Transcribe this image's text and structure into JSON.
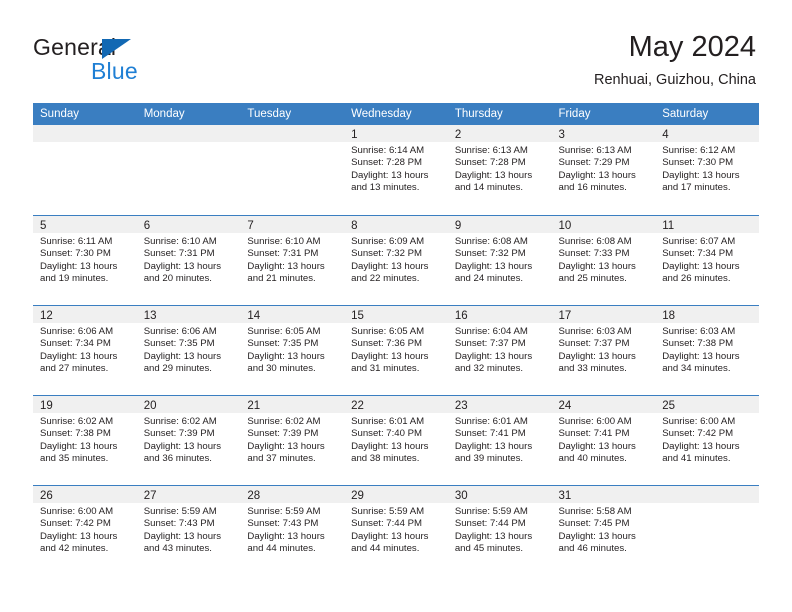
{
  "brand": {
    "name_part1": "General",
    "name_part2": "Blue",
    "triangle_color": "#1268b3",
    "blue_text_color": "#1f7fd4"
  },
  "header": {
    "title": "May 2024",
    "subtitle": "Renhuai, Guizhou, China"
  },
  "theme": {
    "header_blue": "#3a7ec1",
    "daynum_band": "#f0f0f0",
    "text": "#231f20"
  },
  "weekdays": [
    "Sunday",
    "Monday",
    "Tuesday",
    "Wednesday",
    "Thursday",
    "Friday",
    "Saturday"
  ],
  "weeks": [
    [
      {
        "day": "",
        "sunrise": "",
        "sunset": "",
        "daylight1": "",
        "daylight2": ""
      },
      {
        "day": "",
        "sunrise": "",
        "sunset": "",
        "daylight1": "",
        "daylight2": ""
      },
      {
        "day": "",
        "sunrise": "",
        "sunset": "",
        "daylight1": "",
        "daylight2": ""
      },
      {
        "day": "1",
        "sunrise": "Sunrise: 6:14 AM",
        "sunset": "Sunset: 7:28 PM",
        "daylight1": "Daylight: 13 hours",
        "daylight2": "and 13 minutes."
      },
      {
        "day": "2",
        "sunrise": "Sunrise: 6:13 AM",
        "sunset": "Sunset: 7:28 PM",
        "daylight1": "Daylight: 13 hours",
        "daylight2": "and 14 minutes."
      },
      {
        "day": "3",
        "sunrise": "Sunrise: 6:13 AM",
        "sunset": "Sunset: 7:29 PM",
        "daylight1": "Daylight: 13 hours",
        "daylight2": "and 16 minutes."
      },
      {
        "day": "4",
        "sunrise": "Sunrise: 6:12 AM",
        "sunset": "Sunset: 7:30 PM",
        "daylight1": "Daylight: 13 hours",
        "daylight2": "and 17 minutes."
      }
    ],
    [
      {
        "day": "5",
        "sunrise": "Sunrise: 6:11 AM",
        "sunset": "Sunset: 7:30 PM",
        "daylight1": "Daylight: 13 hours",
        "daylight2": "and 19 minutes."
      },
      {
        "day": "6",
        "sunrise": "Sunrise: 6:10 AM",
        "sunset": "Sunset: 7:31 PM",
        "daylight1": "Daylight: 13 hours",
        "daylight2": "and 20 minutes."
      },
      {
        "day": "7",
        "sunrise": "Sunrise: 6:10 AM",
        "sunset": "Sunset: 7:31 PM",
        "daylight1": "Daylight: 13 hours",
        "daylight2": "and 21 minutes."
      },
      {
        "day": "8",
        "sunrise": "Sunrise: 6:09 AM",
        "sunset": "Sunset: 7:32 PM",
        "daylight1": "Daylight: 13 hours",
        "daylight2": "and 22 minutes."
      },
      {
        "day": "9",
        "sunrise": "Sunrise: 6:08 AM",
        "sunset": "Sunset: 7:32 PM",
        "daylight1": "Daylight: 13 hours",
        "daylight2": "and 24 minutes."
      },
      {
        "day": "10",
        "sunrise": "Sunrise: 6:08 AM",
        "sunset": "Sunset: 7:33 PM",
        "daylight1": "Daylight: 13 hours",
        "daylight2": "and 25 minutes."
      },
      {
        "day": "11",
        "sunrise": "Sunrise: 6:07 AM",
        "sunset": "Sunset: 7:34 PM",
        "daylight1": "Daylight: 13 hours",
        "daylight2": "and 26 minutes."
      }
    ],
    [
      {
        "day": "12",
        "sunrise": "Sunrise: 6:06 AM",
        "sunset": "Sunset: 7:34 PM",
        "daylight1": "Daylight: 13 hours",
        "daylight2": "and 27 minutes."
      },
      {
        "day": "13",
        "sunrise": "Sunrise: 6:06 AM",
        "sunset": "Sunset: 7:35 PM",
        "daylight1": "Daylight: 13 hours",
        "daylight2": "and 29 minutes."
      },
      {
        "day": "14",
        "sunrise": "Sunrise: 6:05 AM",
        "sunset": "Sunset: 7:35 PM",
        "daylight1": "Daylight: 13 hours",
        "daylight2": "and 30 minutes."
      },
      {
        "day": "15",
        "sunrise": "Sunrise: 6:05 AM",
        "sunset": "Sunset: 7:36 PM",
        "daylight1": "Daylight: 13 hours",
        "daylight2": "and 31 minutes."
      },
      {
        "day": "16",
        "sunrise": "Sunrise: 6:04 AM",
        "sunset": "Sunset: 7:37 PM",
        "daylight1": "Daylight: 13 hours",
        "daylight2": "and 32 minutes."
      },
      {
        "day": "17",
        "sunrise": "Sunrise: 6:03 AM",
        "sunset": "Sunset: 7:37 PM",
        "daylight1": "Daylight: 13 hours",
        "daylight2": "and 33 minutes."
      },
      {
        "day": "18",
        "sunrise": "Sunrise: 6:03 AM",
        "sunset": "Sunset: 7:38 PM",
        "daylight1": "Daylight: 13 hours",
        "daylight2": "and 34 minutes."
      }
    ],
    [
      {
        "day": "19",
        "sunrise": "Sunrise: 6:02 AM",
        "sunset": "Sunset: 7:38 PM",
        "daylight1": "Daylight: 13 hours",
        "daylight2": "and 35 minutes."
      },
      {
        "day": "20",
        "sunrise": "Sunrise: 6:02 AM",
        "sunset": "Sunset: 7:39 PM",
        "daylight1": "Daylight: 13 hours",
        "daylight2": "and 36 minutes."
      },
      {
        "day": "21",
        "sunrise": "Sunrise: 6:02 AM",
        "sunset": "Sunset: 7:39 PM",
        "daylight1": "Daylight: 13 hours",
        "daylight2": "and 37 minutes."
      },
      {
        "day": "22",
        "sunrise": "Sunrise: 6:01 AM",
        "sunset": "Sunset: 7:40 PM",
        "daylight1": "Daylight: 13 hours",
        "daylight2": "and 38 minutes."
      },
      {
        "day": "23",
        "sunrise": "Sunrise: 6:01 AM",
        "sunset": "Sunset: 7:41 PM",
        "daylight1": "Daylight: 13 hours",
        "daylight2": "and 39 minutes."
      },
      {
        "day": "24",
        "sunrise": "Sunrise: 6:00 AM",
        "sunset": "Sunset: 7:41 PM",
        "daylight1": "Daylight: 13 hours",
        "daylight2": "and 40 minutes."
      },
      {
        "day": "25",
        "sunrise": "Sunrise: 6:00 AM",
        "sunset": "Sunset: 7:42 PM",
        "daylight1": "Daylight: 13 hours",
        "daylight2": "and 41 minutes."
      }
    ],
    [
      {
        "day": "26",
        "sunrise": "Sunrise: 6:00 AM",
        "sunset": "Sunset: 7:42 PM",
        "daylight1": "Daylight: 13 hours",
        "daylight2": "and 42 minutes."
      },
      {
        "day": "27",
        "sunrise": "Sunrise: 5:59 AM",
        "sunset": "Sunset: 7:43 PM",
        "daylight1": "Daylight: 13 hours",
        "daylight2": "and 43 minutes."
      },
      {
        "day": "28",
        "sunrise": "Sunrise: 5:59 AM",
        "sunset": "Sunset: 7:43 PM",
        "daylight1": "Daylight: 13 hours",
        "daylight2": "and 44 minutes."
      },
      {
        "day": "29",
        "sunrise": "Sunrise: 5:59 AM",
        "sunset": "Sunset: 7:44 PM",
        "daylight1": "Daylight: 13 hours",
        "daylight2": "and 44 minutes."
      },
      {
        "day": "30",
        "sunrise": "Sunrise: 5:59 AM",
        "sunset": "Sunset: 7:44 PM",
        "daylight1": "Daylight: 13 hours",
        "daylight2": "and 45 minutes."
      },
      {
        "day": "31",
        "sunrise": "Sunrise: 5:58 AM",
        "sunset": "Sunset: 7:45 PM",
        "daylight1": "Daylight: 13 hours",
        "daylight2": "and 46 minutes."
      },
      {
        "day": "",
        "sunrise": "",
        "sunset": "",
        "daylight1": "",
        "daylight2": ""
      }
    ]
  ]
}
